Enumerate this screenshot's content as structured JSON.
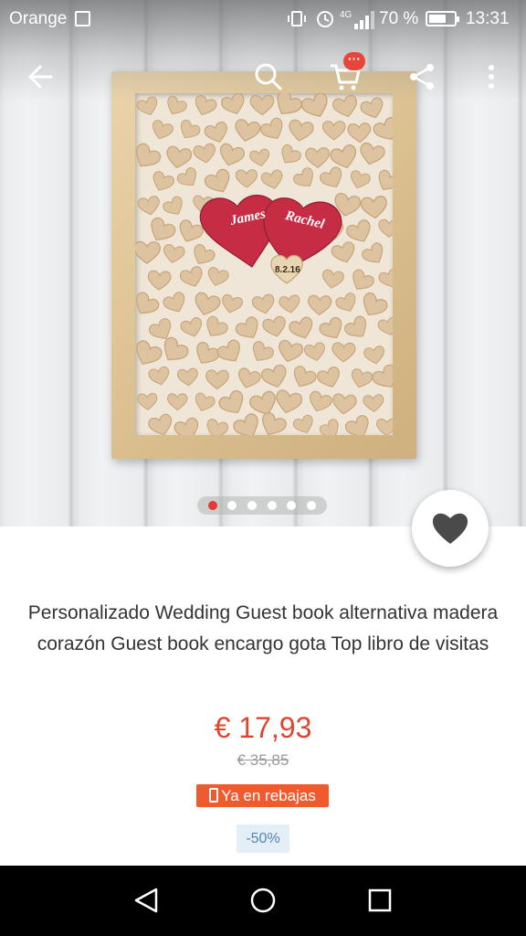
{
  "status_bar": {
    "carrier": "Orange",
    "battery_percent": "70 %",
    "battery_level": 0.7,
    "network": "4G",
    "time": "13:31"
  },
  "toolbar": {
    "icons": [
      "back-arrow-icon",
      "search-icon",
      "cart-icon",
      "share-icon",
      "more-vert-icon"
    ],
    "cart_badge": "···"
  },
  "product_image": {
    "names": [
      "James",
      "Rachel"
    ],
    "date": "8.2.16"
  },
  "carousel": {
    "total": 6,
    "active_index": 0
  },
  "product": {
    "title": "Personalizado Wedding Guest book alternativa madera corazón Guest book encargo gota Top libro de visitas",
    "price": "€ 17,93",
    "original_price": "€ 35,85",
    "sale_label": "Ya en rebajas",
    "discount": "-50%"
  },
  "colors": {
    "price": "#e0452f",
    "sale_tag": "#ef5b2e",
    "discount_bg": "#e3eef7",
    "discount_text": "#4f86b6",
    "dot_active": "#e53935"
  }
}
